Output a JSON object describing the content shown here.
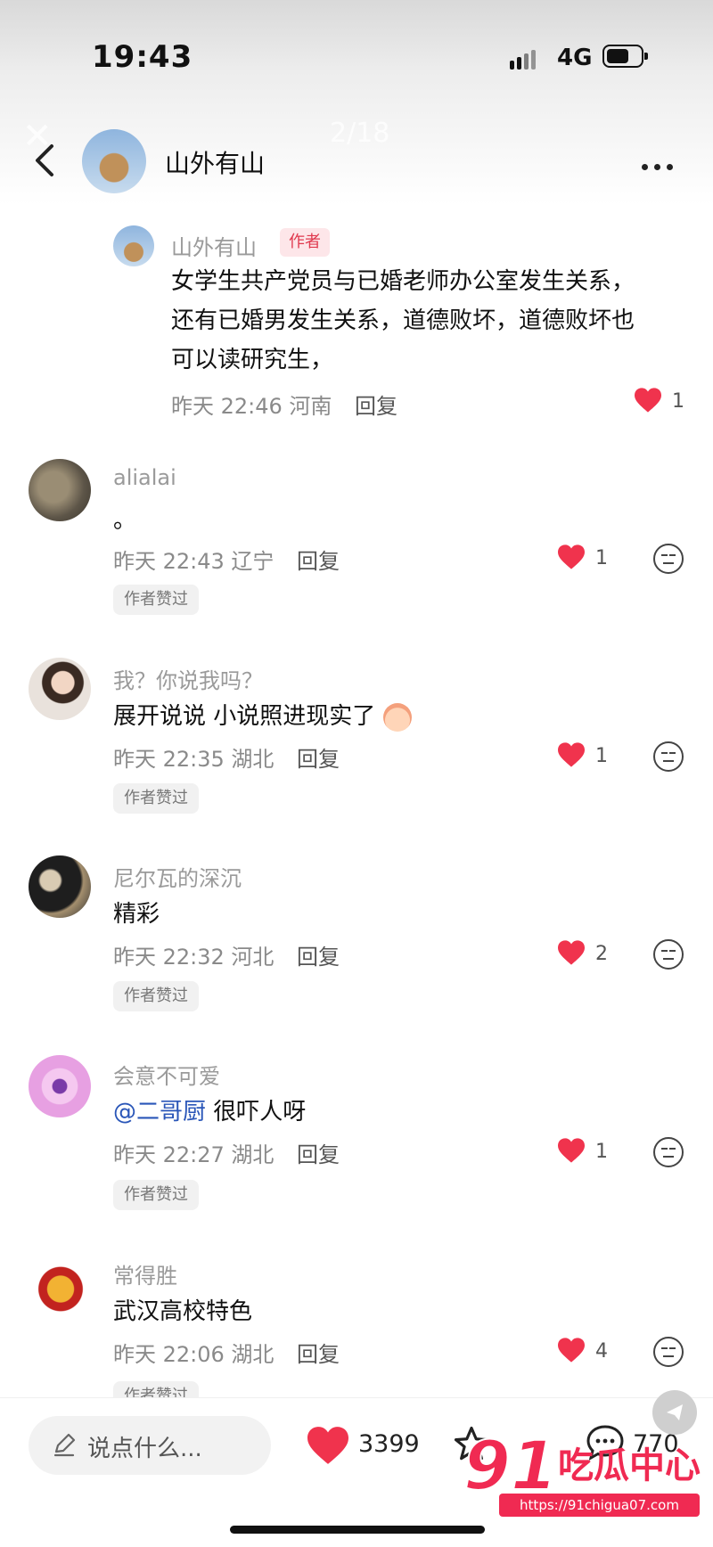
{
  "status_bar": {
    "time": "19:43",
    "network": "4G"
  },
  "viewer": {
    "counter": "2/18"
  },
  "header": {
    "name": "山外有山"
  },
  "author_comment": {
    "name": "山外有山",
    "tag": "作者",
    "text_lines": [
      "女学生共产党员与已婚老师办公室发生关系，",
      "还有已婚男发生关系，道德败坏，道德败坏也",
      "可以读研究生，"
    ],
    "time": "昨天 22:46 河南",
    "reply": "回复",
    "likes": "1"
  },
  "comments": [
    {
      "name": "alialai",
      "text": "。",
      "time": "昨天 22:43 辽宁",
      "reply": "回复",
      "likes": "1",
      "badge": "作者赞过"
    },
    {
      "name": "我？你说我吗？",
      "text": "展开说说 小说照进现实了",
      "time": "昨天 22:35 湖北",
      "reply": "回复",
      "likes": "1",
      "badge": "作者赞过"
    },
    {
      "name": "尼尔瓦的深沉",
      "text": "精彩",
      "time": "昨天 22:32 河北",
      "reply": "回复",
      "likes": "2",
      "badge": "作者赞过"
    },
    {
      "name": "会意不可爱",
      "mention": "@二哥厨",
      "text": " 很吓人呀",
      "time": "昨天 22:27 湖北",
      "reply": "回复",
      "likes": "1",
      "badge": "作者赞过"
    },
    {
      "name": "常得胜",
      "text": "武汉高校特色",
      "time": "昨天 22:06 湖北",
      "reply": "回复",
      "likes": "4",
      "badge": "作者赞过"
    }
  ],
  "bottom_bar": {
    "placeholder": "说点什么...",
    "likes": "3399",
    "comments": "770"
  },
  "watermark": {
    "number": "91",
    "text": "吃瓜中心",
    "url": "https://91chigua07.com"
  },
  "colors": {
    "heart": "#f0334d",
    "author_tag_bg": "#fde6e9",
    "mention": "#2a56b8"
  }
}
